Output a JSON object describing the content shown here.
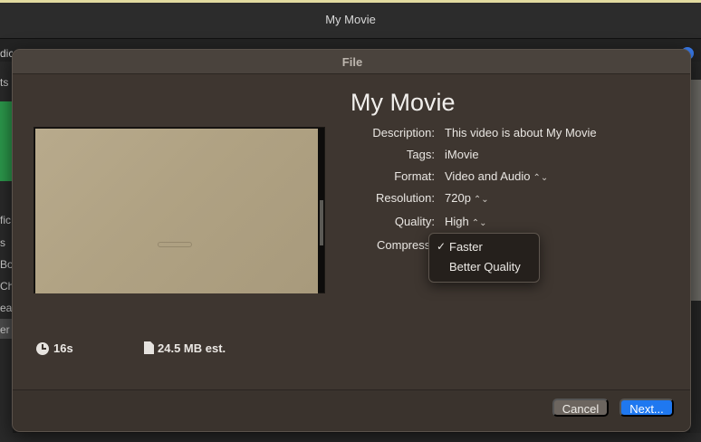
{
  "app": {
    "window_title": "My Movie",
    "left_strip_fragments": [
      "dic",
      "ts",
      "fic",
      "s",
      "Bo",
      "Ch",
      "ea",
      "er"
    ]
  },
  "sheet": {
    "header_title": "File",
    "movie_title": "My Movie",
    "fields": [
      {
        "label": "Description:",
        "value": "This video is about My Movie",
        "type": "text"
      },
      {
        "label": "Tags:",
        "value": "iMovie",
        "type": "text"
      },
      {
        "label": "Format:",
        "value": "Video and Audio",
        "type": "popup"
      },
      {
        "label": "Resolution:",
        "value": "720p",
        "type": "popup"
      },
      {
        "label": "Quality:",
        "value": "High",
        "type": "popup"
      },
      {
        "label": "Compress",
        "value": "Faster",
        "type": "popup"
      }
    ],
    "compress_menu": {
      "options": [
        {
          "label": "Faster",
          "checked": true,
          "check_glyph": "✓"
        },
        {
          "label": "Better Quality",
          "checked": false,
          "check_glyph": ""
        }
      ]
    },
    "duration": "16s",
    "file_size": "24.5 MB est.",
    "buttons": {
      "cancel": "Cancel",
      "next": "Next..."
    }
  },
  "icons": {
    "duration": "clock-icon",
    "file_size": "document-icon",
    "popup": "chevron-up-down-icon"
  },
  "colors": {
    "sheet_bg": "#3e3630",
    "accent": "#1f78f0",
    "cancel_bg": "#6c655f"
  }
}
